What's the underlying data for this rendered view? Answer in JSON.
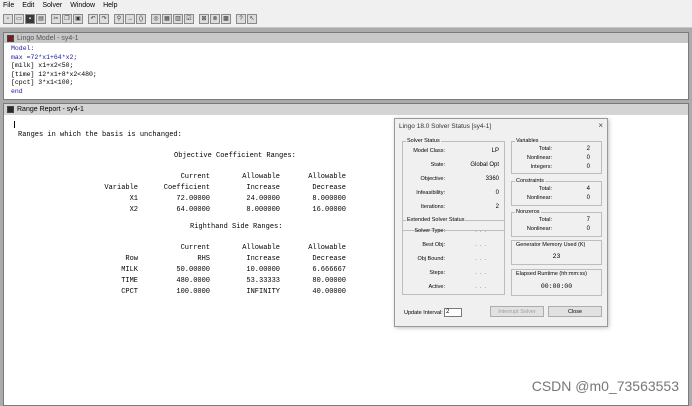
{
  "menubar": {
    "items": [
      "File",
      "Edit",
      "Solver",
      "Window",
      "Help"
    ]
  },
  "toolbar": {
    "buttons": [
      "new-icon",
      "open-icon",
      "save-icon",
      "print-icon",
      "cut-icon",
      "copy-icon",
      "paste-icon",
      "undo-icon",
      "redo-icon",
      "find-icon",
      "goto-icon",
      "match-paren-icon",
      "solve-icon",
      "solution-icon",
      "matrix-icon",
      "options-icon",
      "send-to-back-icon",
      "close-all-icon",
      "tile-icon",
      "help-icon",
      "context-help-icon"
    ]
  },
  "model_window": {
    "title": "Lingo Model - sy4-1",
    "lines": [
      "Model:",
      "max =72*x1+64*x2;",
      "[milk]  x1+x2<50;",
      "[time]  12*x1+8*x2<480;",
      "[cpct]  3*x1<100;",
      "end"
    ]
  },
  "range_window": {
    "title": "Range Report - sy4-1",
    "heading": "Ranges in which the basis is unchanged:",
    "obj": {
      "title": "Objective Coefficient Ranges:",
      "hdr1": [
        "Current",
        "Allowable",
        "Allowable"
      ],
      "hdr2": [
        "Variable",
        "Coefficient",
        "Increase",
        "Decrease"
      ],
      "rows": [
        [
          "X1",
          "72.00000",
          "24.00000",
          "8.000000"
        ],
        [
          "X2",
          "64.00000",
          "8.000000",
          "16.00000"
        ]
      ]
    },
    "rhs": {
      "title": "Righthand Side Ranges:",
      "hdr1": [
        "Current",
        "Allowable",
        "Allowable"
      ],
      "hdr2": [
        "Row",
        "RHS",
        "Increase",
        "Decrease"
      ],
      "rows": [
        [
          "MILK",
          "50.00000",
          "10.00000",
          "6.666667"
        ],
        [
          "TIME",
          "480.0000",
          "53.33333",
          "80.00000"
        ],
        [
          "CPCT",
          "100.0000",
          "INFINITY",
          "40.00000"
        ]
      ]
    }
  },
  "dialog": {
    "title": "Lingo 18.0 Solver Status [sy4-1]",
    "close": "×",
    "solver_status": {
      "label": "Solver Status",
      "model_class_label": "Model Class:",
      "model_class": "LP",
      "state_label": "State:",
      "state": "Global Opt",
      "objective_label": "Objective:",
      "objective": "3360",
      "infeasibility_label": "Infeasibility:",
      "infeasibility": "0",
      "iterations_label": "Iterations:",
      "iterations": "2"
    },
    "extended": {
      "label": "Extended Solver Status",
      "solver_type": "Solver Type:",
      "best_obj": "Best Obj:",
      "obj_bound": "Obj Bound:",
      "steps": "Steps:",
      "active": "Active:",
      "dots": "..."
    },
    "variables": {
      "label": "Variables",
      "total_label": "Total:",
      "total": "2",
      "nonlinear_label": "Nonlinear:",
      "nonlinear": "0",
      "integers_label": "Integers:",
      "integers": "0"
    },
    "constraints": {
      "label": "Constraints",
      "total_label": "Total:",
      "total": "4",
      "nonlinear_label": "Nonlinear:",
      "nonlinear": "0"
    },
    "nonzeros": {
      "label": "Nonzeros",
      "total_label": "Total:",
      "total": "7",
      "nonlinear_label": "Nonlinear:",
      "nonlinear": "0"
    },
    "memory": {
      "label": "Generator Memory Used (K)",
      "value": "23"
    },
    "runtime": {
      "label": "Elapsed Runtime (hh:mm:ss)",
      "value": "00:00:00"
    },
    "update_label": "Update Interval:",
    "update_value": "2",
    "interrupt_label": "Interrupt Solver",
    "close_label": "Close"
  },
  "watermark": "CSDN @m0_73563553"
}
